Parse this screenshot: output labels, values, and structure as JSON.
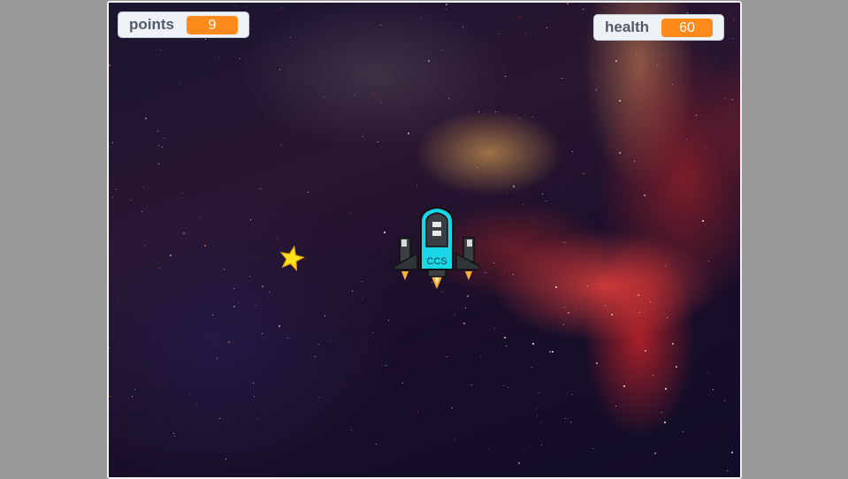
{
  "game": {
    "monitors": {
      "points": {
        "label": "points",
        "value": "9"
      },
      "health": {
        "label": "health",
        "value": "60"
      }
    },
    "spaceship": {
      "label": "CCS"
    }
  },
  "colors": {
    "monitor_value_bg": "#fe8a1b",
    "monitor_bg": "#eef2f7",
    "ship_body": "#1bd6e6",
    "ship_dark": "#3a3f44",
    "star": "#ffe21a",
    "page_bg": "#999999"
  },
  "icons": [
    "spaceship-sprite",
    "star-sprite"
  ]
}
